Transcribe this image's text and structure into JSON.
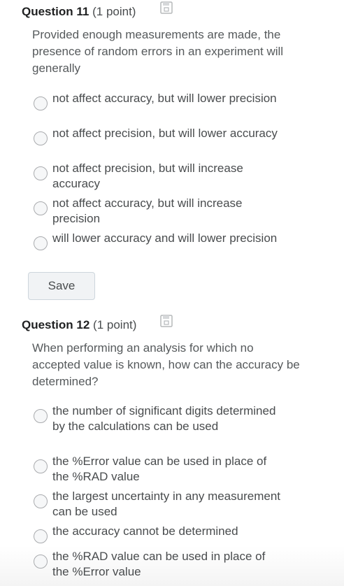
{
  "questions": [
    {
      "number_label": "Question 11",
      "points_label": "(1 point)",
      "text": "Provided enough measurements are made, the presence of random errors in an experiment will generally",
      "options": [
        "not affect accuracy, but will lower precision",
        "not affect precision, but will lower accuracy",
        "not affect precision, but will increase accuracy",
        "not affect accuracy, but will increase precision",
        "will lower accuracy and will lower precision"
      ],
      "save_label": "Save"
    },
    {
      "number_label": "Question 12",
      "points_label": "(1 point)",
      "text": "When performing an analysis for which no accepted value is known, how can the accuracy be determined?",
      "options": [
        "the number of significant digits determined by the calculations can be used",
        "the %Error value can be used in place of the %RAD value",
        "the largest uncertainty in any measurement can be used",
        "the accuracy cannot be determined",
        "the %RAD value can be used in place of the %Error value"
      ]
    }
  ],
  "icons": {
    "unsaved_status": "floppy-disk-icon"
  },
  "colors": {
    "radio_border": "#a9abae",
    "button_bg": "#f1f3f5"
  }
}
